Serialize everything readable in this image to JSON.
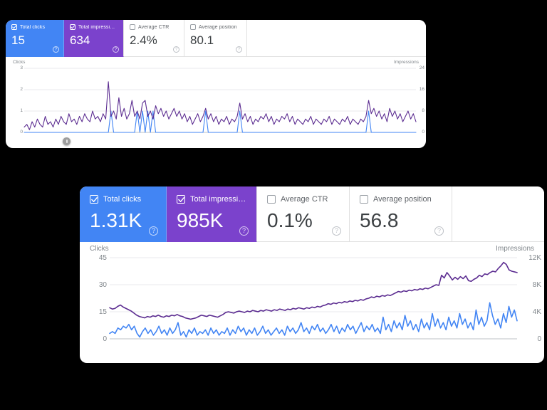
{
  "theme": {
    "background": "#000000",
    "card_background": "#ffffff",
    "clicks_color": "#4285f4",
    "impressions_color": "#5c2d91",
    "active_clicks_tab": "#4285f4",
    "active_impressions_tab": "#7b42cc",
    "label_gray": "#5f6368",
    "value_gray": "#3c4043",
    "axis_gray": "#80868b",
    "grid_gray": "#e8eaed"
  },
  "panels": [
    {
      "id": "top-panel",
      "metrics": [
        {
          "id": "total-clicks",
          "label": "Total clicks",
          "value": "15",
          "checked": true,
          "state": "active-blue",
          "help_icon": "help-icon"
        },
        {
          "id": "total-impressions",
          "label": "Total impressions",
          "value": "634",
          "checked": true,
          "state": "active-purple",
          "help_icon": "help-icon"
        },
        {
          "id": "average-ctr",
          "label": "Average CTR",
          "value": "2.4%",
          "checked": false,
          "state": "inactive",
          "help_icon": "help-icon"
        },
        {
          "id": "average-position",
          "label": "Average position",
          "value": "80.1",
          "checked": false,
          "state": "inactive",
          "help_icon": "help-icon"
        }
      ],
      "chart": {
        "left_axis_title": "Clicks",
        "right_axis_title": "Impressions",
        "left_ticks": [
          "3",
          "2",
          "1",
          "0"
        ],
        "right_ticks": [
          "24",
          "16",
          "8",
          "0"
        ],
        "range_handle": "date-range-handle"
      }
    },
    {
      "id": "bottom-panel",
      "metrics": [
        {
          "id": "total-clicks",
          "label": "Total clicks",
          "value": "1.31K",
          "checked": true,
          "state": "active-blue",
          "help_icon": "help-icon"
        },
        {
          "id": "total-impressions",
          "label": "Total impressions",
          "value": "985K",
          "checked": true,
          "state": "active-purple",
          "help_icon": "help-icon"
        },
        {
          "id": "average-ctr",
          "label": "Average CTR",
          "value": "0.1%",
          "checked": false,
          "state": "inactive",
          "help_icon": "help-icon"
        },
        {
          "id": "average-position",
          "label": "Average position",
          "value": "56.8",
          "checked": false,
          "state": "inactive",
          "help_icon": "help-icon"
        }
      ],
      "chart": {
        "left_axis_title": "Clicks",
        "right_axis_title": "Impressions",
        "left_ticks": [
          "45",
          "30",
          "15",
          "0"
        ],
        "right_ticks": [
          "12K",
          "8K",
          "4K",
          "0"
        ]
      }
    }
  ],
  "chart_data": [
    {
      "id": "top-panel-chart",
      "type": "line",
      "title": "",
      "xlabel": "",
      "ylabel": "Clicks",
      "y2label": "Impressions",
      "ylim": [
        0,
        3
      ],
      "y2lim": [
        0,
        24
      ],
      "yticks": [
        0,
        1,
        2,
        3
      ],
      "y2ticks": [
        0,
        8,
        16,
        24
      ],
      "grid": true,
      "legend": "none",
      "series": [
        {
          "name": "Clicks",
          "axis": "left",
          "color": "#4285f4",
          "values": [
            0,
            0,
            0,
            0,
            0,
            0,
            0,
            0,
            0,
            0,
            0,
            0,
            0,
            0,
            0,
            0,
            0,
            0,
            0,
            0,
            0,
            0,
            0,
            0,
            0,
            0,
            0,
            0,
            0,
            0,
            0,
            0,
            0,
            1,
            0,
            0,
            0,
            0,
            0,
            0,
            0,
            0,
            0,
            1,
            0,
            1,
            0,
            1,
            0,
            1,
            0,
            0,
            0,
            0,
            0,
            0,
            0,
            0,
            0,
            0,
            0,
            0,
            0,
            0,
            0,
            0,
            0,
            0,
            0,
            1,
            0,
            0,
            0,
            0,
            0,
            0,
            0,
            0,
            0,
            0,
            0,
            0,
            1,
            0,
            0,
            0,
            0,
            0,
            0,
            0,
            0,
            0,
            0,
            0,
            0,
            0,
            0,
            0,
            0,
            0,
            0,
            0,
            0,
            0,
            0,
            0,
            0,
            0,
            0,
            0,
            0,
            0,
            0,
            0,
            0,
            0,
            0,
            0,
            0,
            0,
            0,
            0,
            0,
            0,
            0,
            0,
            0,
            0,
            0,
            0,
            0,
            1,
            0,
            0,
            0,
            0,
            0,
            0,
            0,
            0,
            0,
            0,
            0,
            0,
            0,
            0,
            0,
            0,
            0,
            0
          ]
        },
        {
          "name": "Impressions",
          "axis": "right",
          "color": "#5c2d91",
          "values": [
            2,
            3,
            1,
            4,
            2,
            5,
            3,
            2,
            6,
            3,
            4,
            2,
            5,
            3,
            6,
            4,
            3,
            7,
            4,
            5,
            3,
            6,
            4,
            7,
            5,
            4,
            8,
            5,
            6,
            4,
            7,
            5,
            19,
            6,
            8,
            5,
            13,
            6,
            9,
            5,
            7,
            12,
            6,
            8,
            5,
            11,
            12,
            6,
            8,
            5,
            10,
            7,
            9,
            6,
            8,
            5,
            7,
            9,
            6,
            8,
            5,
            7,
            4,
            6,
            3,
            5,
            7,
            4,
            6,
            9,
            5,
            7,
            4,
            6,
            3,
            5,
            4,
            6,
            3,
            5,
            4,
            6,
            11,
            5,
            7,
            4,
            6,
            3,
            5,
            4,
            6,
            5,
            7,
            4,
            6,
            3,
            5,
            4,
            6,
            5,
            7,
            4,
            6,
            3,
            5,
            4,
            3,
            5,
            4,
            6,
            3,
            5,
            4,
            3,
            5,
            4,
            6,
            3,
            5,
            4,
            3,
            5,
            4,
            6,
            3,
            5,
            4,
            3,
            5,
            4,
            6,
            12,
            7,
            9,
            6,
            8,
            5,
            7,
            4,
            9,
            6,
            8,
            5,
            7,
            4,
            6,
            8,
            5,
            7,
            4
          ]
        }
      ]
    },
    {
      "id": "bottom-panel-chart",
      "type": "line",
      "title": "",
      "xlabel": "",
      "ylabel": "Clicks",
      "y2label": "Impressions",
      "ylim": [
        0,
        45
      ],
      "y2lim": [
        0,
        12000
      ],
      "yticks": [
        0,
        15,
        30,
        45
      ],
      "y2ticks": [
        0,
        4000,
        8000,
        12000
      ],
      "grid": true,
      "legend": "none",
      "series": [
        {
          "name": "Clicks",
          "axis": "left",
          "color": "#4285f4",
          "values": [
            3,
            4,
            3,
            6,
            5,
            7,
            6,
            8,
            5,
            7,
            3,
            1,
            4,
            6,
            3,
            5,
            2,
            4,
            7,
            3,
            5,
            2,
            6,
            3,
            5,
            9,
            2,
            4,
            1,
            5,
            3,
            6,
            2,
            4,
            3,
            5,
            2,
            6,
            3,
            5,
            2,
            4,
            3,
            6,
            2,
            5,
            3,
            7,
            4,
            6,
            2,
            5,
            3,
            6,
            2,
            4,
            7,
            3,
            5,
            2,
            4,
            6,
            3,
            5,
            2,
            7,
            4,
            6,
            3,
            5,
            9,
            4,
            6,
            3,
            7,
            5,
            8,
            4,
            6,
            3,
            5,
            8,
            4,
            7,
            3,
            6,
            4,
            8,
            5,
            7,
            3,
            6,
            9,
            4,
            7,
            5,
            8,
            4,
            6,
            3,
            12,
            5,
            8,
            4,
            10,
            6,
            9,
            5,
            13,
            7,
            10,
            5,
            8,
            4,
            11,
            6,
            9,
            5,
            14,
            7,
            11,
            6,
            9,
            5,
            12,
            7,
            10,
            6,
            14,
            8,
            11,
            6,
            9,
            5,
            16,
            8,
            12,
            7,
            10,
            20,
            13,
            8,
            11,
            6,
            14,
            9,
            18,
            12,
            16,
            10
          ]
        },
        {
          "name": "Impressions",
          "axis": "right",
          "color": "#5c2d91",
          "values": [
            4600,
            4400,
            4500,
            4800,
            5000,
            4700,
            4500,
            4300,
            4100,
            3800,
            3500,
            3300,
            3200,
            3100,
            3300,
            3200,
            3400,
            3300,
            3500,
            3300,
            3200,
            3400,
            3300,
            3500,
            3400,
            3600,
            3400,
            3300,
            3100,
            3000,
            2900,
            3000,
            3100,
            3300,
            3500,
            3400,
            3300,
            3500,
            3400,
            3300,
            3200,
            3400,
            3600,
            3900,
            4000,
            3900,
            3800,
            4000,
            4100,
            4000,
            3900,
            4100,
            4000,
            4200,
            4100,
            4000,
            4200,
            4100,
            4300,
            4200,
            4100,
            4300,
            4200,
            4400,
            4300,
            4200,
            4400,
            4300,
            4500,
            4400,
            4600,
            4500,
            4400,
            4600,
            4500,
            4700,
            4600,
            4800,
            4700,
            4900,
            5000,
            5200,
            5100,
            5300,
            5200,
            5400,
            5300,
            5500,
            5400,
            5600,
            5500,
            5700,
            5600,
            5800,
            5700,
            5900,
            6000,
            6200,
            6100,
            6300,
            6200,
            6400,
            6300,
            6500,
            6400,
            6600,
            6800,
            7000,
            6900,
            7100,
            7000,
            7200,
            7100,
            7300,
            7200,
            7400,
            7300,
            7500,
            7400,
            7600,
            7800,
            8000,
            7900,
            9400,
            9000,
            9800,
            9300,
            8700,
            9100,
            8800,
            9200,
            8900,
            9300,
            8600,
            8500,
            8800,
            9000,
            9400,
            9200,
            9600,
            9500,
            9800,
            10000,
            9900,
            10400,
            10800,
            11300,
            11000,
            10200,
            10000,
            9900,
            9800
          ]
        }
      ]
    }
  ]
}
